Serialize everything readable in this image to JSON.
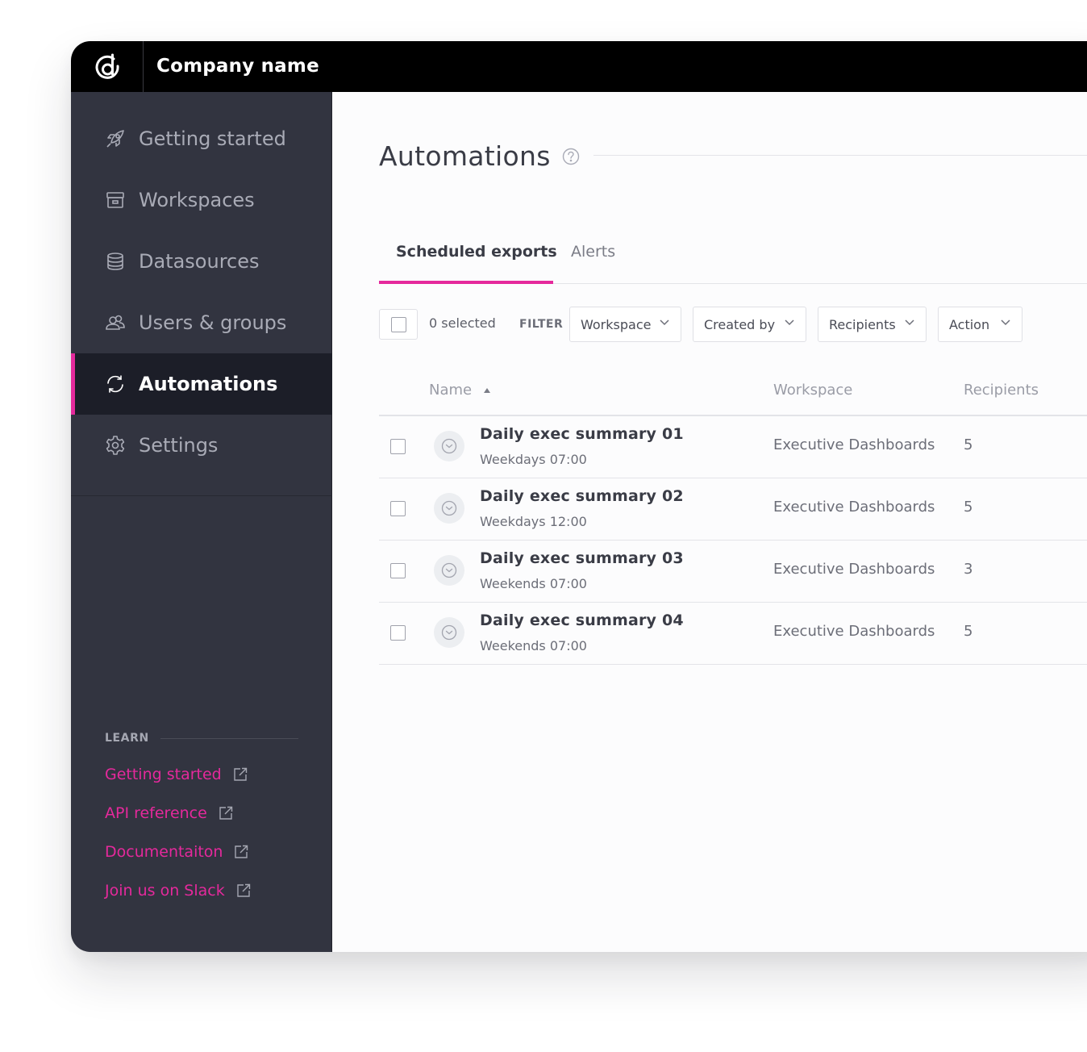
{
  "app": {
    "company_name": "Company name",
    "logo_icon": "brand-logo-icon"
  },
  "sidebar": {
    "items": [
      {
        "label": "Getting started",
        "icon": "rocket-icon",
        "active": false
      },
      {
        "label": "Workspaces",
        "icon": "archive-box-icon",
        "active": false
      },
      {
        "label": "Datasources",
        "icon": "database-icon",
        "active": false
      },
      {
        "label": "Users & groups",
        "icon": "users-icon",
        "active": false
      },
      {
        "label": "Automations",
        "icon": "refresh-icon",
        "active": true
      },
      {
        "label": "Settings",
        "icon": "gear-icon",
        "active": false
      }
    ],
    "learn": {
      "heading": "LEARN",
      "links": [
        {
          "label": "Getting started",
          "icon": "external-link-icon"
        },
        {
          "label": "API reference",
          "icon": "external-link-icon"
        },
        {
          "label": "Documentaiton",
          "icon": "external-link-icon"
        },
        {
          "label": "Join us on Slack",
          "icon": "external-link-icon"
        }
      ]
    }
  },
  "main": {
    "title": "Automations",
    "help_icon": "help-circle-icon",
    "tabs": [
      {
        "label": "Scheduled exports",
        "active": true
      },
      {
        "label": "Alerts",
        "active": false
      }
    ],
    "filter": {
      "selected_count": "0 selected",
      "label": "FILTER",
      "dropdowns": [
        "Workspace",
        "Created by",
        "Recipients",
        "Action"
      ]
    },
    "table": {
      "columns": {
        "name": "Name",
        "workspace": "Workspace",
        "recipients": "Recipients"
      },
      "sort_indicator": "sort-ascending-icon",
      "rows": [
        {
          "name": "Daily exec summary 01",
          "schedule": "Weekdays 07:00",
          "workspace": "Executive Dashboards",
          "recipients": "5"
        },
        {
          "name": "Daily exec summary 02",
          "schedule": "Weekdays 12:00",
          "workspace": "Executive Dashboards",
          "recipients": "5"
        },
        {
          "name": "Daily exec summary 03",
          "schedule": "Weekends 07:00",
          "workspace": "Executive Dashboards",
          "recipients": "3"
        },
        {
          "name": "Daily exec summary 04",
          "schedule": "Weekends 07:00",
          "workspace": "Executive Dashboards",
          "recipients": "5"
        }
      ]
    }
  },
  "colors": {
    "accent": "#e5299c",
    "sidebar_bg": "#323440",
    "sidebar_active_bg": "#1c1e28",
    "topbar_bg": "#000000"
  }
}
